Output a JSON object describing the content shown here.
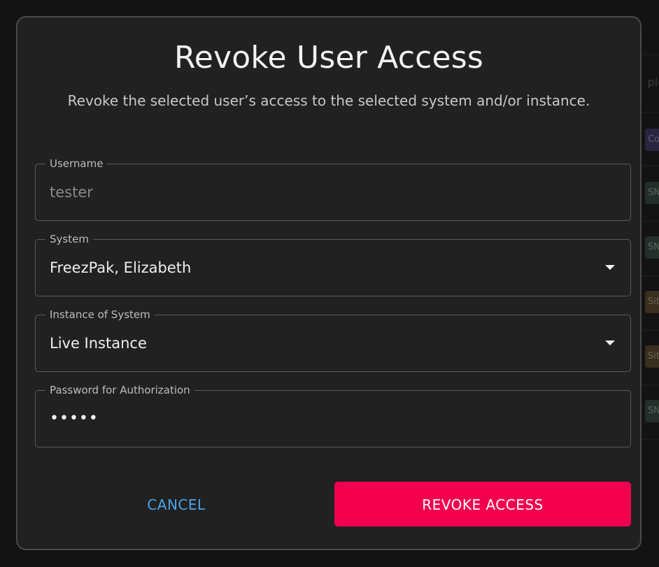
{
  "background": {
    "partial_texts": [
      "ple",
      "Co",
      "SN",
      "SN",
      "Sit",
      "Sit",
      "SN"
    ]
  },
  "dialog": {
    "title": "Revoke User Access",
    "subtitle": "Revoke the selected user’s access to the selected system and/or instance.",
    "fields": {
      "username": {
        "label": "Username",
        "value": "tester",
        "disabled": true
      },
      "system": {
        "label": "System",
        "value": "FreezPak, Elizabeth",
        "icon": "dropdown-arrow-icon"
      },
      "instance": {
        "label": "Instance of System",
        "value": "Live Instance",
        "icon": "dropdown-arrow-icon"
      },
      "password": {
        "label": "Password for Authorization",
        "value": "•••••"
      }
    },
    "actions": {
      "cancel_label": "CANCEL",
      "revoke_label": "REVOKE ACCESS"
    }
  },
  "colors": {
    "accent": "#f2004f",
    "link": "#4aa3e8",
    "dialog_bg": "#212121"
  }
}
